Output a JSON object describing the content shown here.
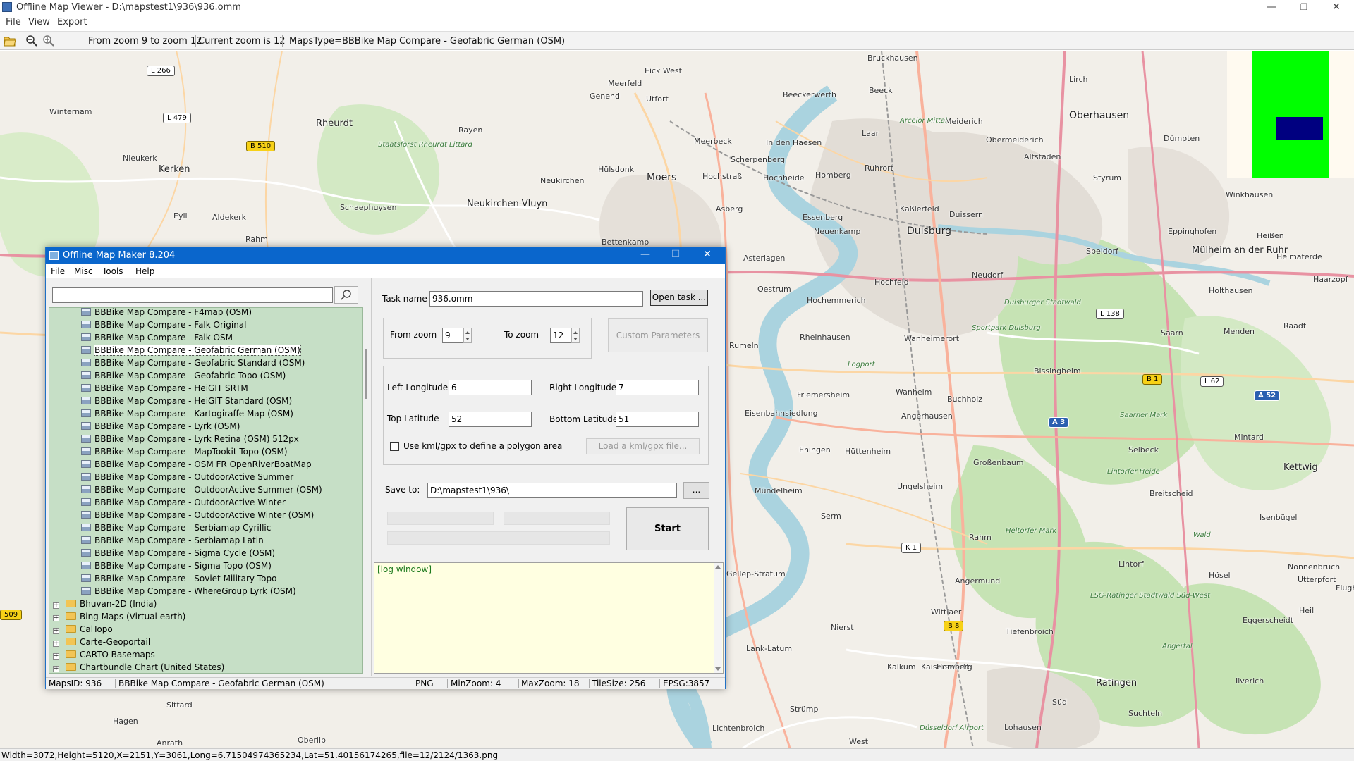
{
  "window": {
    "title": "Offline Map Viewer - D:\\mapstest1\\936\\936.omm",
    "menu": [
      "File",
      "View",
      "Export"
    ]
  },
  "toolbar": {
    "zoom_range": "From zoom 9 to zoom 12",
    "current_zoom": "Current zoom is 12",
    "maps_type": "MapsType=BBBike Map Compare - Geofabric German (OSM)"
  },
  "map": {
    "big_labels": [
      "Duisburg",
      "Moers",
      "Oberhausen",
      "Kerken",
      "Rheurdt",
      "Neukirchen-Vluyn",
      "Mülheim an der Ruhr",
      "Ratingen",
      "Kettwig"
    ],
    "labels": [
      "Winternam",
      "Nieukerk",
      "Aldekerk",
      "Eyll",
      "Rahm",
      "Schaephuysen",
      "Rayen",
      "Eick West",
      "Meerfeld",
      "Genend",
      "Utfort",
      "Bruckhausen",
      "Beeckerwerth",
      "Beeck",
      "Laar",
      "Meiderich",
      "Obermeiderich",
      "Lirch",
      "Altstaden",
      "Styrum",
      "Dümpten",
      "Winkhausen",
      "Heißen",
      "Eppinghofen",
      "Speldorf",
      "Heimaterde",
      "Haarzopf",
      "Holthausen",
      "Menden",
      "Saarn",
      "Raadt",
      "Meerbeck",
      "In den Haesen",
      "Scherpenberg",
      "Hochheide",
      "Homberg",
      "Ruhrort",
      "Hochstraß",
      "Hülsdonk",
      "Neukirchen",
      "Asberg",
      "Essenberg",
      "Kaßlerfeld",
      "Duissern",
      "Neuenkamp",
      "Bettenkamp",
      "Asterlagen",
      "Hochfeld",
      "Neudorf",
      "Oestrum",
      "Hochemmerich",
      "Rheinhausen",
      "Wanheimerort",
      "Rumeln",
      "Bissingheim",
      "Friemersheim",
      "Wanheim",
      "Buchholz",
      "Eisenbahnsiedlung",
      "Angerhausen",
      "Ehingen",
      "Hüttenheim",
      "Selbeck",
      "Mintard",
      "Breitscheid",
      "Isenbügel",
      "Großenbaum",
      "Ungelsheim",
      "Mündelheim",
      "Rahm",
      "Serm",
      "Lintorf",
      "Hösel",
      "Gellep-Stratum",
      "Angermund",
      "Wittlaer",
      "Eggerscheidt",
      "Lank-Latum",
      "Nierst",
      "Tiefenbroich",
      "Kaiserswerth",
      "Kalkum",
      "Homberg",
      "Ilverich",
      "Strümp",
      "Lichtenbroich",
      "Lohausen",
      "West",
      "Süd",
      "Suchteln",
      "Hagen",
      "Sittard",
      "Anrath",
      "Oberlip",
      "Utterpfort",
      "Nonnenbruch",
      "Heil",
      "Flughafen Essen-Mülheim"
    ],
    "water_green_labels": [
      "Staatsforst Rheurdt Littard",
      "Arcelor Mittal",
      "Sportpark Duisburg",
      "Duisburger Stadtwald",
      "Saarner Mark",
      "Lintorfer Heide",
      "Heltorfer Mark",
      "LSG-Ratinger Stadtwald Süd-West",
      "Logport",
      "Angertal",
      "Düsseldorf Airport",
      "Wald"
    ],
    "shields": [
      "L 266",
      "L 479",
      "B 510",
      "L 138",
      "B 1",
      "L 62",
      "A 52",
      "A 3",
      "K 1",
      "B 8",
      "509"
    ]
  },
  "minimap": {
    "colors": {
      "background": "#fffaf0",
      "extent": "#00ff00",
      "viewport": "#000080"
    }
  },
  "status_bar": {
    "text": "Width=3072,Height=5120,X=2151,Y=3061,Long=6.71504974365234,Lat=51.40156174265,file=12/2124/1363.png"
  },
  "dialog": {
    "title": "Offline Map Maker 8.204",
    "menu": [
      "File",
      "Misc",
      "Tools",
      "Help"
    ],
    "search": {
      "value": "",
      "placeholder": ""
    },
    "tree_items": [
      {
        "label": "BBBike Map Compare - F4map (OSM)",
        "selected": false
      },
      {
        "label": "BBBike Map Compare - Falk Original",
        "selected": false
      },
      {
        "label": "BBBike Map Compare - Falk OSM",
        "selected": false
      },
      {
        "label": "BBBike Map Compare - Geofabric German (OSM)",
        "selected": true
      },
      {
        "label": "BBBike Map Compare - Geofabric Standard (OSM)",
        "selected": false
      },
      {
        "label": "BBBike Map Compare - Geofabric Topo (OSM)",
        "selected": false
      },
      {
        "label": "BBBike Map Compare - HeiGIT SRTM",
        "selected": false
      },
      {
        "label": "BBBike Map Compare - HeiGIT Standard (OSM)",
        "selected": false
      },
      {
        "label": "BBBike Map Compare - Kartogiraffe Map (OSM)",
        "selected": false
      },
      {
        "label": "BBBike Map Compare - Lyrk (OSM)",
        "selected": false
      },
      {
        "label": "BBBike Map Compare - Lyrk Retina (OSM) 512px",
        "selected": false
      },
      {
        "label": "BBBike Map Compare - MapTookit Topo (OSM)",
        "selected": false
      },
      {
        "label": "BBBike Map Compare - OSM FR OpenRiverBoatMap",
        "selected": false
      },
      {
        "label": "BBBike Map Compare - OutdoorActive Summer",
        "selected": false
      },
      {
        "label": "BBBike Map Compare - OutdoorActive Summer (OSM)",
        "selected": false
      },
      {
        "label": "BBBike Map Compare - OutdoorActive Winter",
        "selected": false
      },
      {
        "label": "BBBike Map Compare - OutdoorActive Winter (OSM)",
        "selected": false
      },
      {
        "label": "BBBike Map Compare - Serbiamap Cyrillic",
        "selected": false
      },
      {
        "label": "BBBike Map Compare - Serbiamap Latin",
        "selected": false
      },
      {
        "label": "BBBike Map Compare - Sigma Cycle (OSM)",
        "selected": false
      },
      {
        "label": "BBBike Map Compare - Sigma Topo (OSM)",
        "selected": false
      },
      {
        "label": "BBBike Map Compare - Soviet Military Topo",
        "selected": false
      },
      {
        "label": "BBBike Map Compare - WhereGroup Lyrk (OSM)",
        "selected": false
      }
    ],
    "tree_folders": [
      "Bhuvan-2D (India)",
      "Bing Maps (Virtual earth)",
      "CalTopo",
      "Carte-Geoportail",
      "CARTO Basemaps",
      "Chartbundle Chart (United States)"
    ],
    "task_name_label": "Task name",
    "task_name_value": "936.omm",
    "open_task_label": "Open task ...",
    "from_zoom_label": "From zoom",
    "from_zoom_value": "9",
    "to_zoom_label": "To zoom",
    "to_zoom_value": "12",
    "custom_params_label": "Custom Parameters",
    "left_lon_label": "Left Longitude",
    "left_lon_value": "6",
    "right_lon_label": "Right Longitude",
    "right_lon_value": "7",
    "top_lat_label": "Top Latitude",
    "top_lat_value": "52",
    "bottom_lat_label": "Bottom Latitude",
    "bottom_lat_value": "51",
    "kml_checkbox_label": "Use kml/gpx to define a polygon area",
    "load_kml_label": "Load a kml/gpx file...",
    "save_to_label": "Save to:",
    "save_to_value": "D:\\mapstest1\\936\\",
    "browse_label": "...",
    "start_label": "Start",
    "log_text": "[log window]",
    "status": {
      "maps_id": "MapsID: 936",
      "map_name": "BBBike Map Compare - Geofabric German (OSM)",
      "format": "PNG",
      "min_zoom": "MinZoom: 4",
      "max_zoom": "MaxZoom: 18",
      "tile_size": "TileSize: 256",
      "epsg": "EPSG:3857"
    }
  }
}
